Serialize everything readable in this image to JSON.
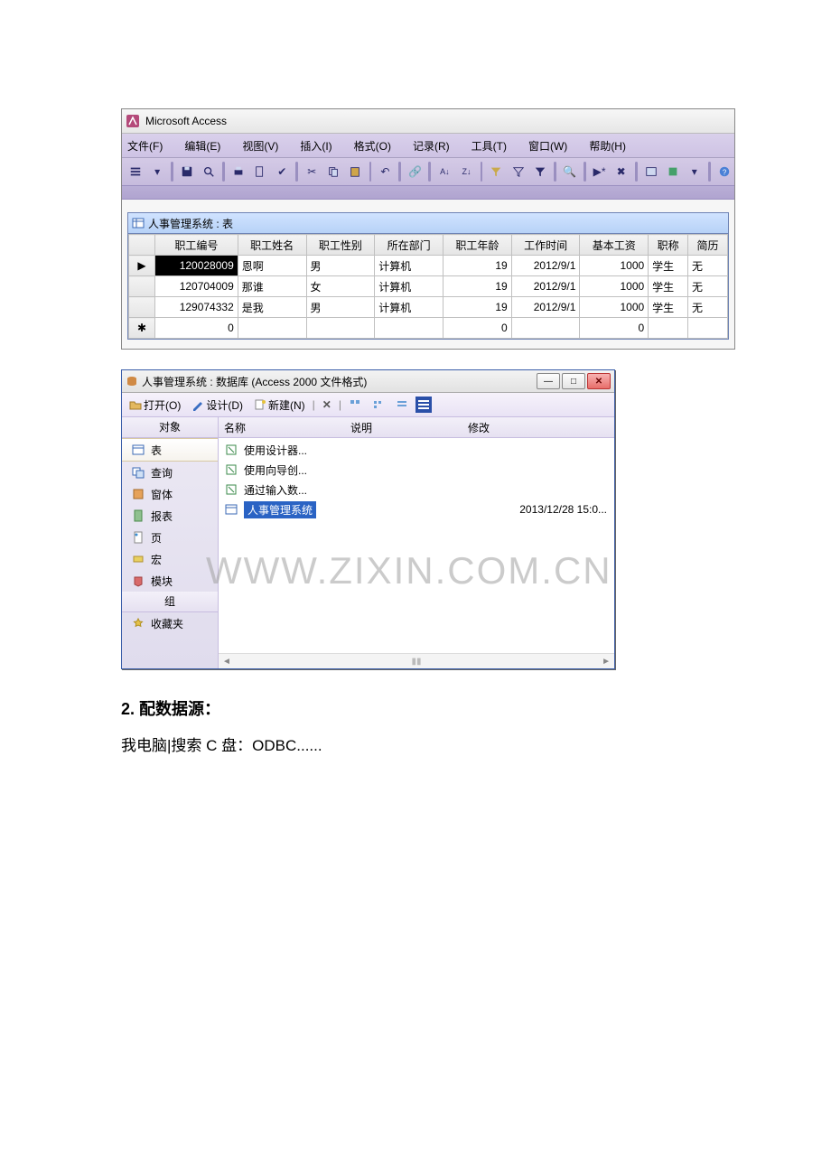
{
  "app": {
    "title": "Microsoft Access"
  },
  "menus": {
    "file": "文件(F)",
    "edit": "编辑(E)",
    "view": "视图(V)",
    "insert": "插入(I)",
    "format": "格式(O)",
    "records": "记录(R)",
    "tools": "工具(T)",
    "window": "窗口(W)",
    "help": "帮助(H)"
  },
  "inner_window": {
    "title": "人事管理系统 : 表"
  },
  "table": {
    "headers": [
      "职工编号",
      "职工姓名",
      "职工性别",
      "所在部门",
      "职工年龄",
      "工作时间",
      "基本工资",
      "职称",
      "简历"
    ],
    "rows": [
      {
        "selected": true,
        "cells": [
          "120028009",
          "恩啊",
          "男",
          "计算机",
          "19",
          "2012/9/1",
          "1000",
          "学生",
          "无"
        ]
      },
      {
        "selected": false,
        "cells": [
          "120704009",
          "那谁",
          "女",
          "计算机",
          "19",
          "2012/9/1",
          "1000",
          "学生",
          "无"
        ]
      },
      {
        "selected": false,
        "cells": [
          "129074332",
          "是我",
          "男",
          "计算机",
          "19",
          "2012/9/1",
          "1000",
          "学生",
          "无"
        ]
      }
    ],
    "newrow": [
      "0",
      "",
      "",
      "",
      "0",
      "",
      "0",
      "",
      ""
    ]
  },
  "db_window": {
    "title": "人事管理系统 : 数据库 (Access 2000 文件格式)",
    "toolbar": {
      "open": "打开(O)",
      "design": "设计(D)",
      "new": "新建(N)"
    },
    "nav": {
      "header_objects": "对象",
      "items": [
        "表",
        "查询",
        "窗体",
        "报表",
        "页",
        "宏",
        "模块"
      ],
      "header_groups": "组",
      "favorites": "收藏夹"
    },
    "list": {
      "head_name": "名称",
      "head_desc": "说明",
      "head_mod": "修改",
      "items": [
        {
          "label": "使用设计器...",
          "date": ""
        },
        {
          "label": "使用向导创...",
          "date": ""
        },
        {
          "label": "通过输入数...",
          "date": ""
        },
        {
          "label": "人事管理系统",
          "date": "2013/12/28 15:0...",
          "selected": true
        }
      ]
    }
  },
  "doc": {
    "heading": "2. 配数据源：",
    "body": "我电脑|搜索 C 盘：ODBC......"
  },
  "watermark": "WWW.ZIXIN.COM.CN"
}
